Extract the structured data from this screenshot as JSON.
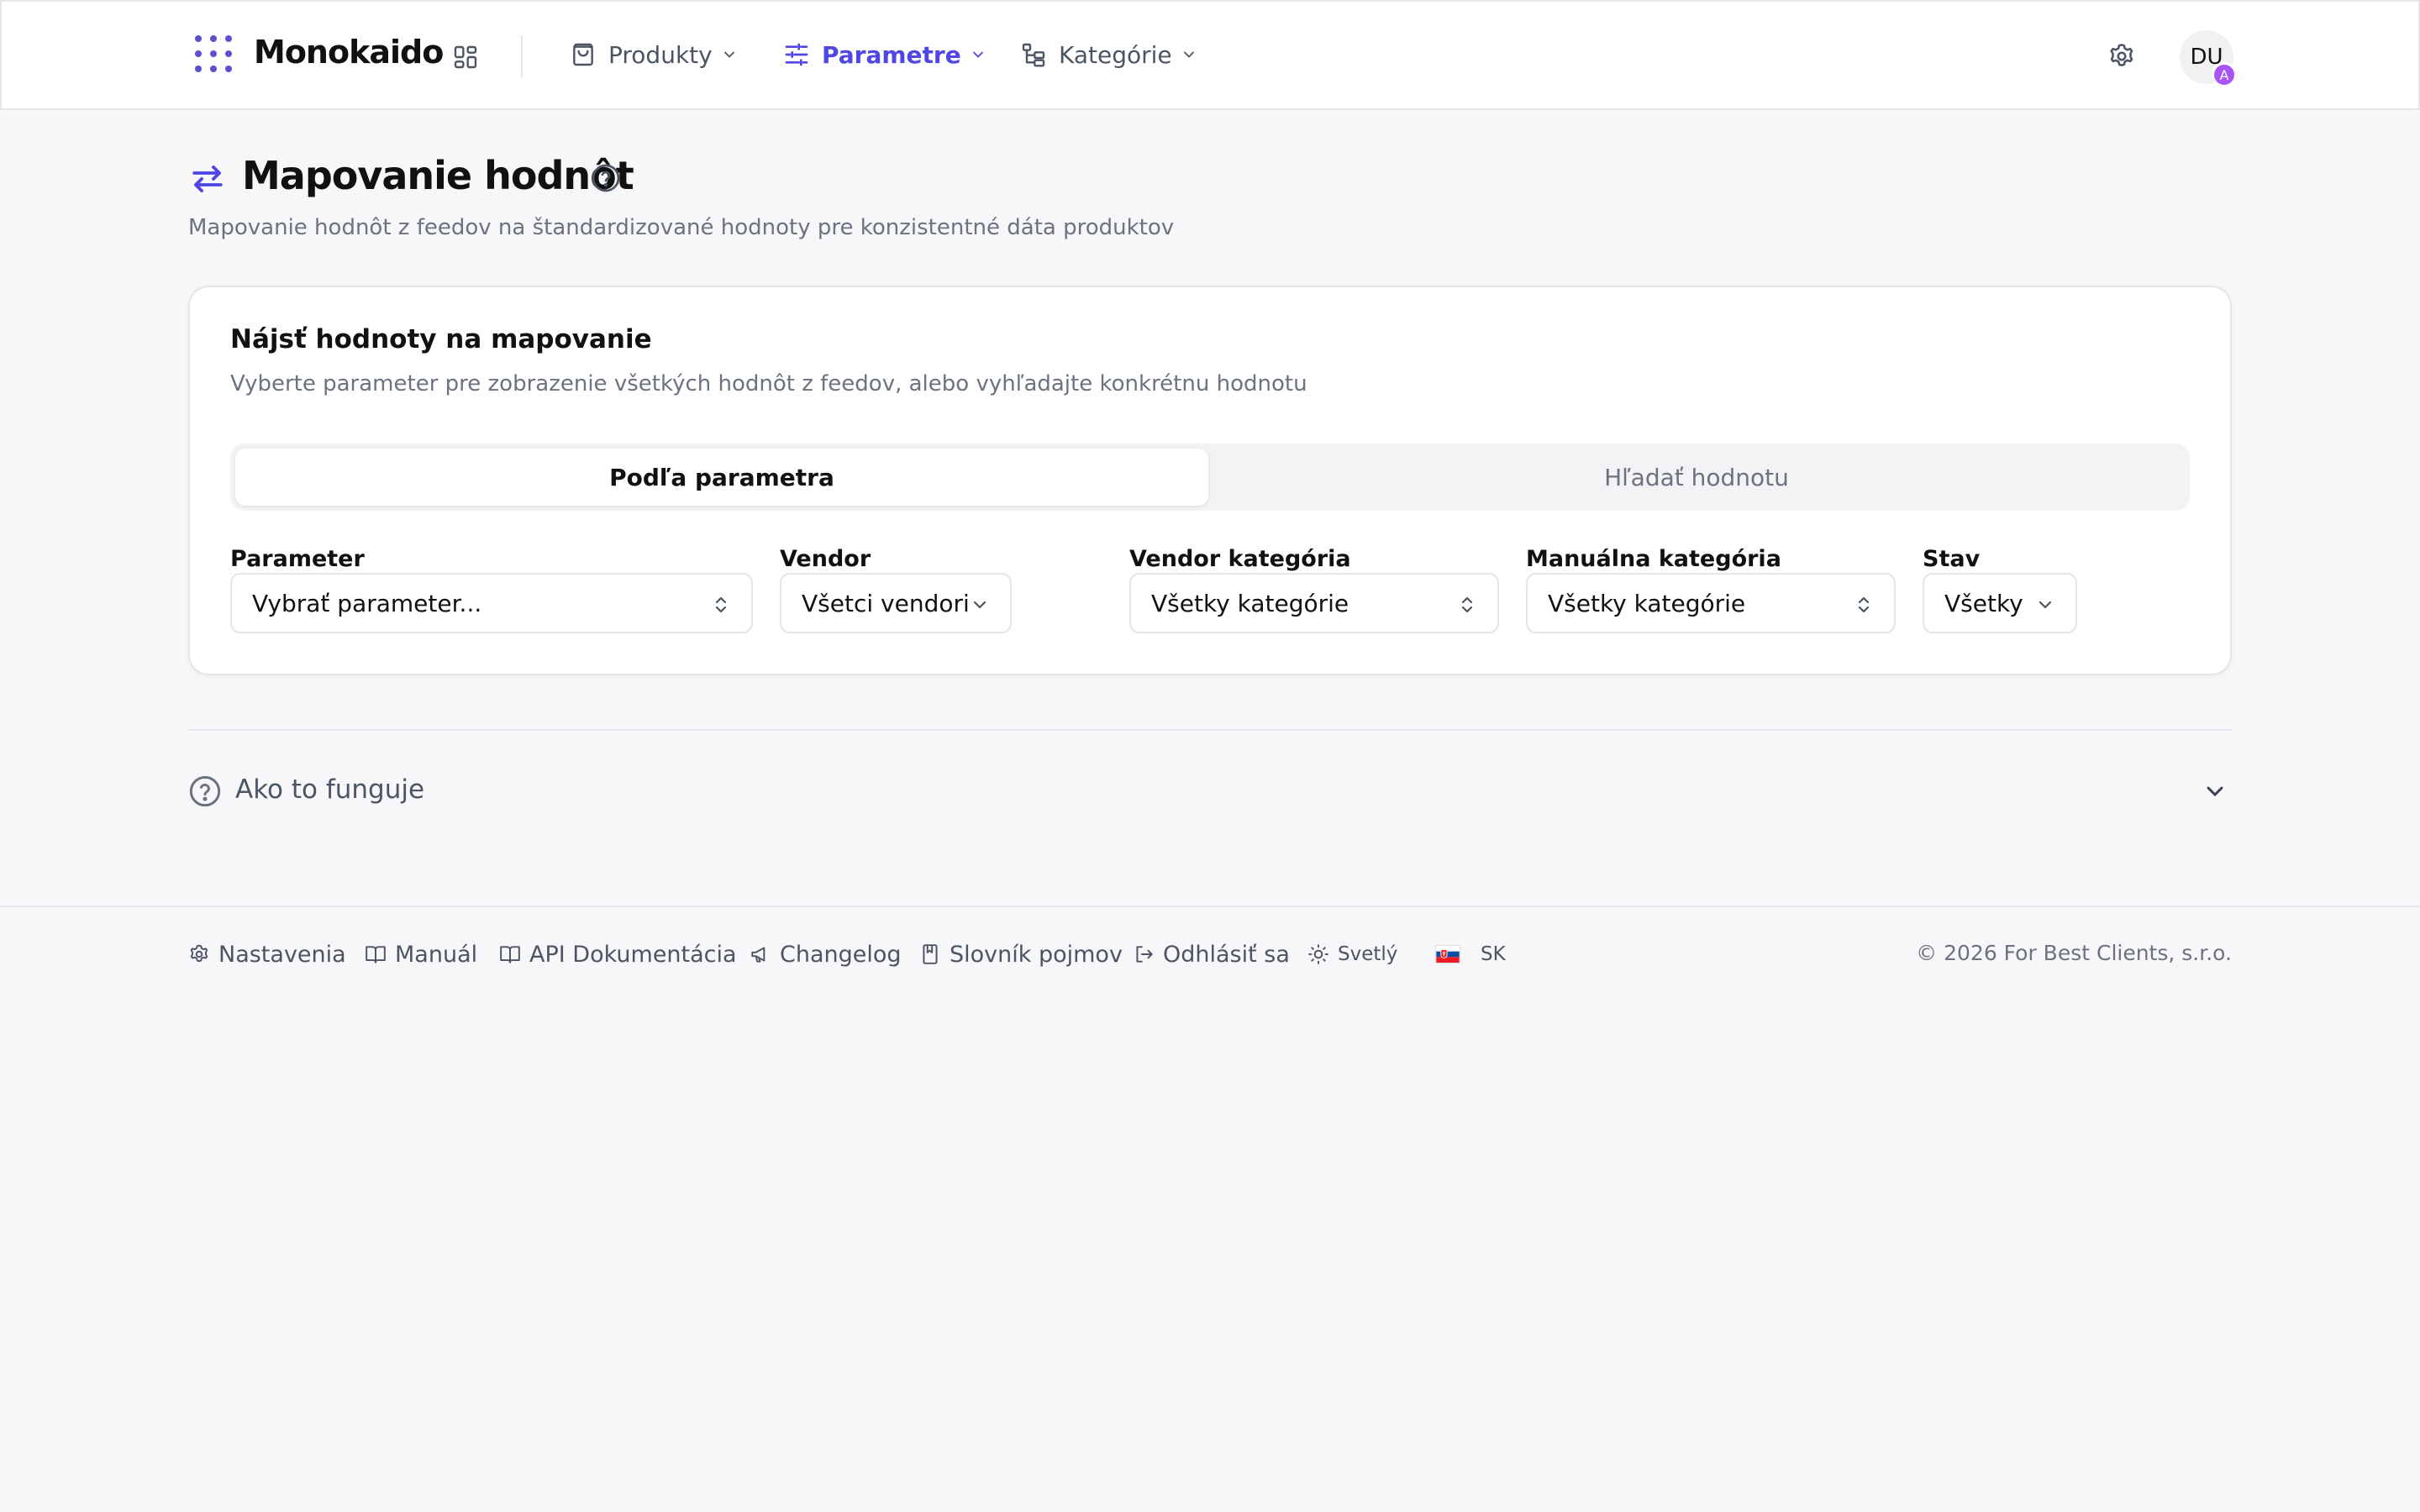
{
  "header": {
    "brand": "Monokaido",
    "nav": [
      {
        "label": "Produkty",
        "icon": "shopping-bag-icon"
      },
      {
        "label": "Parametre",
        "icon": "sliders-icon",
        "active": true
      },
      {
        "label": "Kategórie",
        "icon": "category-tree-icon"
      }
    ],
    "avatar_initials": "DU",
    "avatar_badge": "A"
  },
  "page": {
    "title": "Mapovanie hodnôt",
    "subtitle": "Mapovanie hodnôt z feedov na štandardizované hodnoty pre konzistentné dáta produktov"
  },
  "card": {
    "title": "Nájsť hodnoty na mapovanie",
    "description": "Vyberte parameter pre zobrazenie všetkých hodnôt z feedov, alebo vyhľadajte konkrétnu hodnotu",
    "tabs": [
      {
        "label": "Podľa parametra",
        "active": true
      },
      {
        "label": "Hľadať hodnotu",
        "active": false
      }
    ],
    "filters": {
      "parameter": {
        "label": "Parameter",
        "value": "Vybrať parameter..."
      },
      "vendor": {
        "label": "Vendor",
        "value": "Všetci vendori"
      },
      "vendor_category": {
        "label": "Vendor kategória",
        "value": "Všetky kategórie"
      },
      "manual_category": {
        "label": "Manuálna kategória",
        "value": "Všetky kategórie"
      },
      "status": {
        "label": "Stav",
        "value": "Všetky"
      }
    }
  },
  "accordion": {
    "title": "Ako to funguje"
  },
  "footer": {
    "links": [
      {
        "label": "Nastavenia",
        "icon": "gear-icon"
      },
      {
        "label": "Manuál",
        "icon": "book-open-icon"
      },
      {
        "label": "API Dokumentácia",
        "icon": "book-open-icon"
      },
      {
        "label": "Changelog",
        "icon": "megaphone-icon"
      },
      {
        "label": "Slovník pojmov",
        "icon": "bookmark-book-icon"
      },
      {
        "label": "Odhlásiť sa",
        "icon": "logout-icon"
      }
    ],
    "theme": "Svetlý",
    "language": "SK",
    "copyright": "© 2026 For Best Clients, s.r.o."
  },
  "colors": {
    "accent": "#4f46e5",
    "badge": "#a855f7",
    "background": "#f7f6f9"
  }
}
